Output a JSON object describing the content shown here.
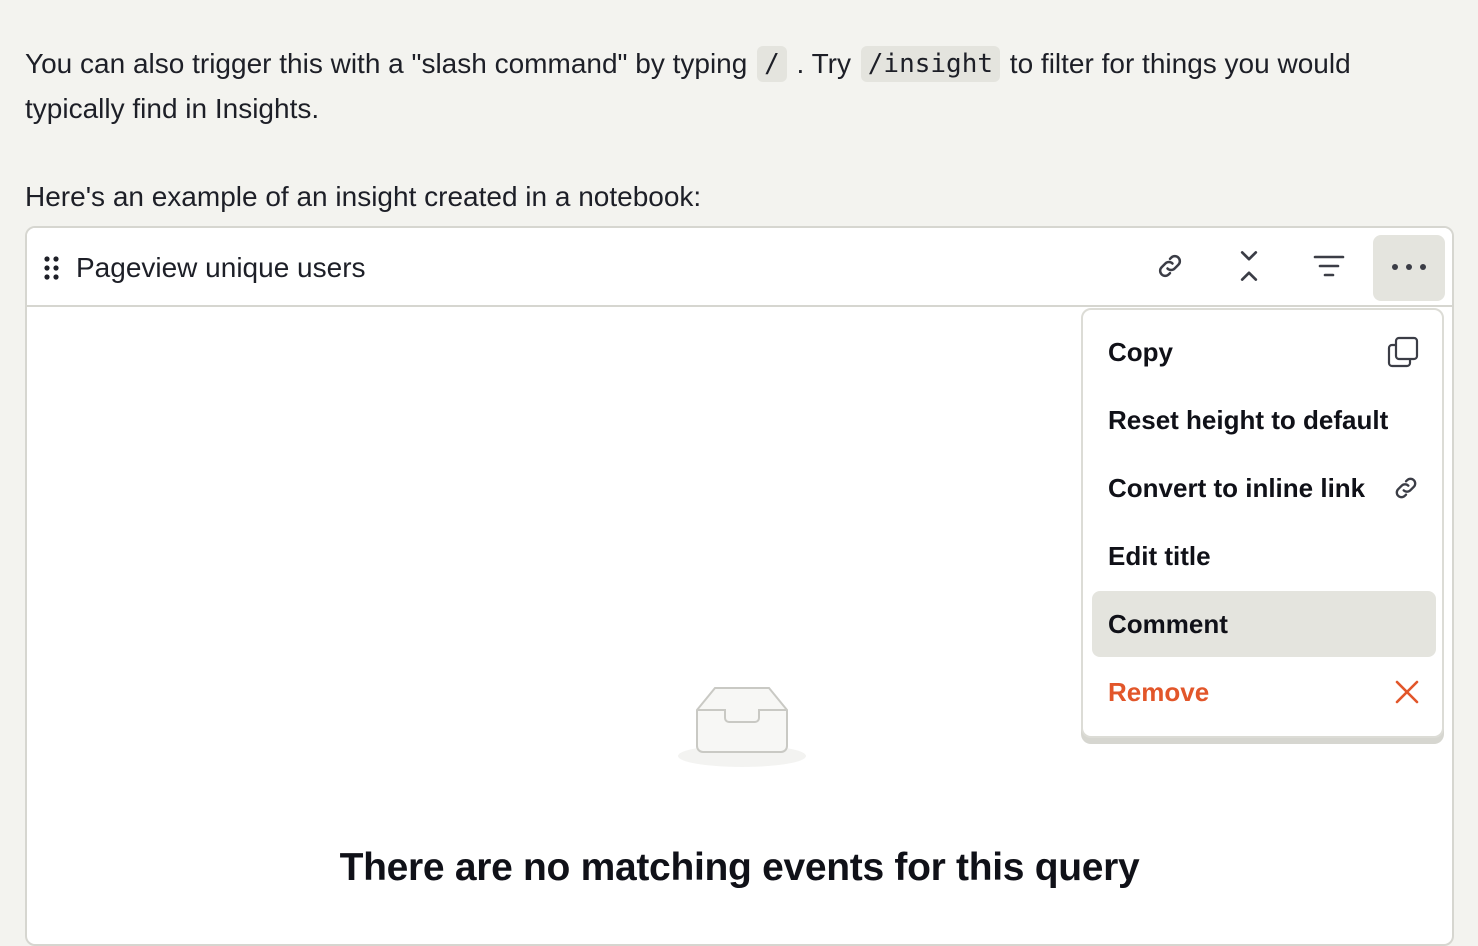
{
  "doc": {
    "line1_before": "You can also trigger this with a \"slash command\" by typing",
    "slash_code": "/",
    "line1_middle": ". Try",
    "insight_code": "/insight",
    "line1_after": "to filter for things you would",
    "line2": "typically find in Insights.",
    "line3": "Here's an example of an insight created in a notebook:"
  },
  "card": {
    "title": "Pageview unique users",
    "header_icons": [
      "link-icon",
      "collapse-icon",
      "filter-icon",
      "more-icon"
    ],
    "empty_state": {
      "title": "There are no matching events for this query"
    }
  },
  "menu": {
    "items": [
      {
        "label": "Copy",
        "icon": "copy-icon"
      },
      {
        "label": "Reset height to default"
      },
      {
        "label": "Convert to inline link",
        "icon": "link-icon"
      },
      {
        "label": "Edit title"
      },
      {
        "label": "Comment",
        "state": "highlighted"
      },
      {
        "label": "Remove",
        "icon": "close-icon"
      }
    ]
  },
  "colors": {
    "page_background": "#f3f3ef",
    "danger": "#e2562a",
    "hover": "#e4e4de"
  }
}
